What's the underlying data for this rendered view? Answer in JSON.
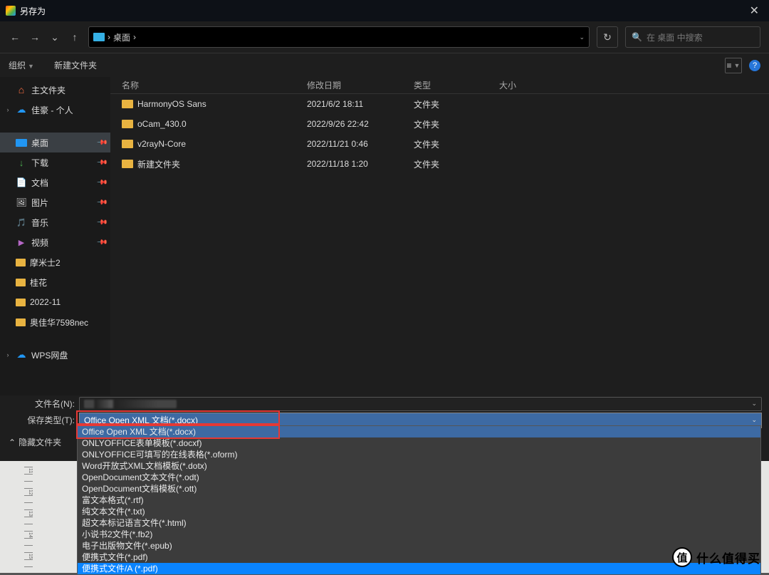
{
  "title": "另存为",
  "nav": {
    "chevron_down": "⌄"
  },
  "path": {
    "root": "›",
    "segment": "桌面",
    "sep": "›"
  },
  "search": {
    "icon": "🔍",
    "placeholder": "在 桌面 中搜索"
  },
  "cmd": {
    "organize": "组织",
    "new_folder": "新建文件夹",
    "view_icon": "≡",
    "help": "?"
  },
  "tree": {
    "home": "主文件夹",
    "personal": "佳豪 - 个人",
    "desktop": "桌面",
    "downloads": "下载",
    "documents": "文档",
    "pictures": "图片",
    "music": "音乐",
    "videos": "视频",
    "f1": "摩米士2",
    "f2": "桂花",
    "f3": "2022-11",
    "f4": "奥佳华7598nec",
    "wps": "WPS网盘"
  },
  "cols": {
    "name": "名称",
    "date": "修改日期",
    "type": "类型",
    "size": "大小"
  },
  "files": [
    {
      "name": "HarmonyOS Sans",
      "date": "2021/6/2 18:11",
      "type": "文件夹"
    },
    {
      "name": "oCam_430.0",
      "date": "2022/9/26 22:42",
      "type": "文件夹"
    },
    {
      "name": "v2rayN-Core",
      "date": "2022/11/21 0:46",
      "type": "文件夹"
    },
    {
      "name": "新建文件夹",
      "date": "2022/11/18 1:20",
      "type": "文件夹"
    }
  ],
  "bottom": {
    "filename_label": "文件名(N):",
    "filetype_label": "保存类型(T):",
    "filetype_selected": "Office Open XML 文档(*.docx)",
    "hide": "隐藏文件夹",
    "hide_chevron": "⌃"
  },
  "options": [
    "Office Open XML 文档(*.docx)",
    "ONLYOFFICE表单模板(*.docxf)",
    "ONLYOFFICE可填写的在线表格(*.oform)",
    "Word开放式XML文档模板(*.dotx)",
    "OpenDocument文本文件(*.odt)",
    "OpenDocument文档模板(*.ott)",
    "富文本格式(*.rtf)",
    "纯文本文件(*.txt)",
    "超文本标记语言文件(*.html)",
    "小说书2文件(*.fb2)",
    "电子出版物文件(*.epub)",
    "便携式文件(*.pdf)",
    "便携式文件/A (*.pdf)"
  ],
  "watermark": {
    "badge": "值",
    "text": "什么值得买"
  },
  "ruler": {
    "n1": "11",
    "n2": "12",
    "n3": "13",
    "n4": "14",
    "n5": "15"
  }
}
